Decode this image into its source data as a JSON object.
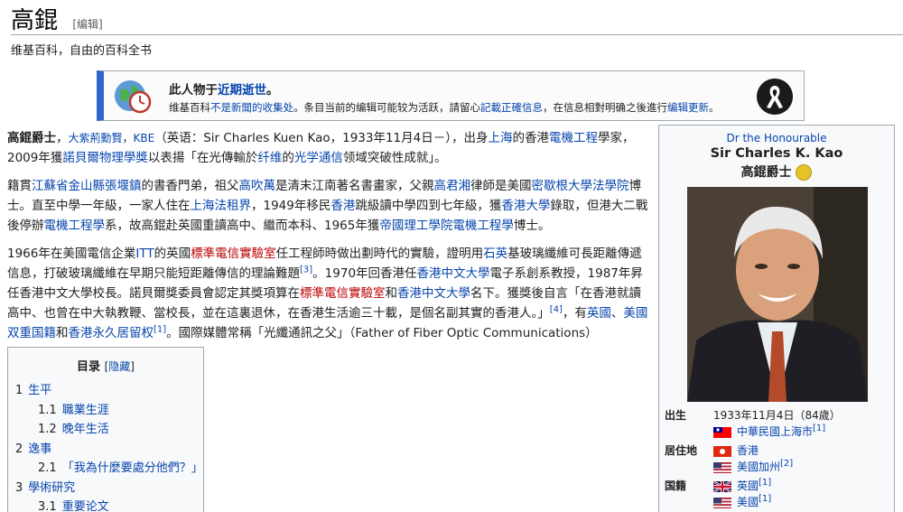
{
  "page": {
    "title": "高錕",
    "edit_label": "[编辑]",
    "subtitle": "维基百科，自由的百科全书"
  },
  "notice": {
    "title_prefix": "此人物于",
    "title_link": "近期逝世",
    "title_suffix": "。",
    "text_1": "维基百科",
    "text_link_1": "不是新聞的收集处",
    "text_2": "。条目当前的编辑可能较为活跃，請留心",
    "text_link_2": "記載正確信息",
    "text_3": "，在信息相對明确之後進行",
    "text_link_3": "编辑更新",
    "text_4": "。"
  },
  "content": {
    "p1": [
      {
        "t": "高錕爵士",
        "b": true
      },
      {
        "t": "，"
      },
      {
        "t": "大紫荊勳賢",
        "link": true,
        "small": true
      },
      {
        "t": "，",
        "small": true
      },
      {
        "t": "KBE",
        "link": true,
        "small": true
      },
      {
        "t": "（英语：Sir Charles Kuen Kao，1933年11月4日－），出身"
      },
      {
        "t": "上海",
        "link": true
      },
      {
        "t": "的香港"
      },
      {
        "t": "電機工程",
        "link": true
      },
      {
        "t": "學家，2009年獲"
      },
      {
        "t": "諾貝爾物理學獎",
        "link": true
      },
      {
        "t": "以表揚「在光傳輸於"
      },
      {
        "t": "纤维",
        "link": true
      },
      {
        "t": "的"
      },
      {
        "t": "光学通信",
        "link": true
      },
      {
        "t": "领域突破性成就」。"
      }
    ],
    "p2": [
      {
        "t": "籍貫"
      },
      {
        "t": "江蘇省金山縣張堰鎮",
        "link": true
      },
      {
        "t": "的書香門弟，祖父"
      },
      {
        "t": "高吹萬",
        "link": true
      },
      {
        "t": "是清末江南著名書畫家，父親"
      },
      {
        "t": "高君湘",
        "link": true
      },
      {
        "t": "律師是美國"
      },
      {
        "t": "密歇根大學法學院",
        "link": true
      },
      {
        "t": "博士。直至中學一年級，一家人住在"
      },
      {
        "t": "上海法租界",
        "link": true
      },
      {
        "t": "，1949年移民"
      },
      {
        "t": "香港",
        "link": true
      },
      {
        "t": "跳級讀中學四到七年級，獲"
      },
      {
        "t": "香港大學",
        "link": true
      },
      {
        "t": "錄取，但港大二戰後停辦"
      },
      {
        "t": "電機工程學",
        "link": true
      },
      {
        "t": "系，故高錕赴英國重讀高中、繼而本科、1965年獲"
      },
      {
        "t": "帝國理工學院",
        "link": true
      },
      {
        "t": "電機工程學",
        "link": true
      },
      {
        "t": "博士。"
      }
    ],
    "p3": [
      {
        "t": "1966年在美國電信企業"
      },
      {
        "t": "ITT",
        "link": true
      },
      {
        "t": "的英國"
      },
      {
        "t": "標準電信實驗室",
        "red": true
      },
      {
        "t": "任工程師時做出劃時代的實驗，證明用"
      },
      {
        "t": "石英",
        "link": true
      },
      {
        "t": "基玻璃纖維可長距離傳遞信息，打破玻璃纖維在早期只能短距離傳信的理論難題"
      },
      {
        "t": "[3]",
        "sup": true
      },
      {
        "t": "。1970年回香港任"
      },
      {
        "t": "香港中文大學",
        "link": true
      },
      {
        "t": "電子系創系教授，1987年昇任香港中文大學校長。諾貝爾獎委員會認定其獎項算在"
      },
      {
        "t": "標準電信實驗室",
        "red": true
      },
      {
        "t": "和"
      },
      {
        "t": "香港中文大學",
        "link": true
      },
      {
        "t": "名下。獲獎後自言「在香港就讀高中、也曾在中大執教鞭、當校長，並在這裏退休，在香港生活逾三十載，是個名副其實的香港人。」"
      },
      {
        "t": "[4]",
        "sup": true
      },
      {
        "t": "，有"
      },
      {
        "t": "英國",
        "link": true
      },
      {
        "t": "、"
      },
      {
        "t": "美國双重国籍",
        "link": true
      },
      {
        "t": "和"
      },
      {
        "t": "香港永久居留权",
        "link": true
      },
      {
        "t": "[1]",
        "sup": true
      },
      {
        "t": "。國際媒體常稱「光纖通訊之父」（Father of Fiber Optic Communications）"
      }
    ]
  },
  "toc": {
    "heading": "目录",
    "hide_label": "隐藏",
    "items": [
      {
        "num": "1",
        "label": "生平",
        "level": 1
      },
      {
        "num": "1.1",
        "label": "職業生涯",
        "level": 2
      },
      {
        "num": "1.2",
        "label": "晚年生活",
        "level": 2
      },
      {
        "num": "2",
        "label": "逸事",
        "level": 1
      },
      {
        "num": "2.1",
        "label": "「我為什麼要處分他們？」",
        "level": 2
      },
      {
        "num": "3",
        "label": "學術研究",
        "level": 1
      },
      {
        "num": "3.1",
        "label": "重要论文",
        "level": 2
      }
    ]
  },
  "infobox": {
    "pre_title": "Dr the Honourable",
    "name_en": "Sir Charles K. Kao",
    "name_cn": "高錕爵士",
    "born_label": "出生",
    "born_date": "1933年11月4日（84歲）",
    "born_place": "中華民國上海市",
    "born_ref": "[1]",
    "residence_label": "居住地",
    "residence_1": "香港",
    "residence_2": "美國加州",
    "residence_ref": "[2]",
    "nationality_label": "国籍",
    "nationality_1": "英國",
    "nationality_2": "美國",
    "nationality_ref": "[1]"
  },
  "colors": {
    "link": "#0645ad",
    "red_link": "#ba0000",
    "notice_bar": "#3366cc",
    "border": "#a2a9b1"
  },
  "icons": [
    "globe-clock-icon",
    "black-ribbon-icon",
    "laurel-badge-icon",
    "flag-roc-icon",
    "flag-hk-icon",
    "flag-us-icon",
    "flag-uk-icon"
  ]
}
